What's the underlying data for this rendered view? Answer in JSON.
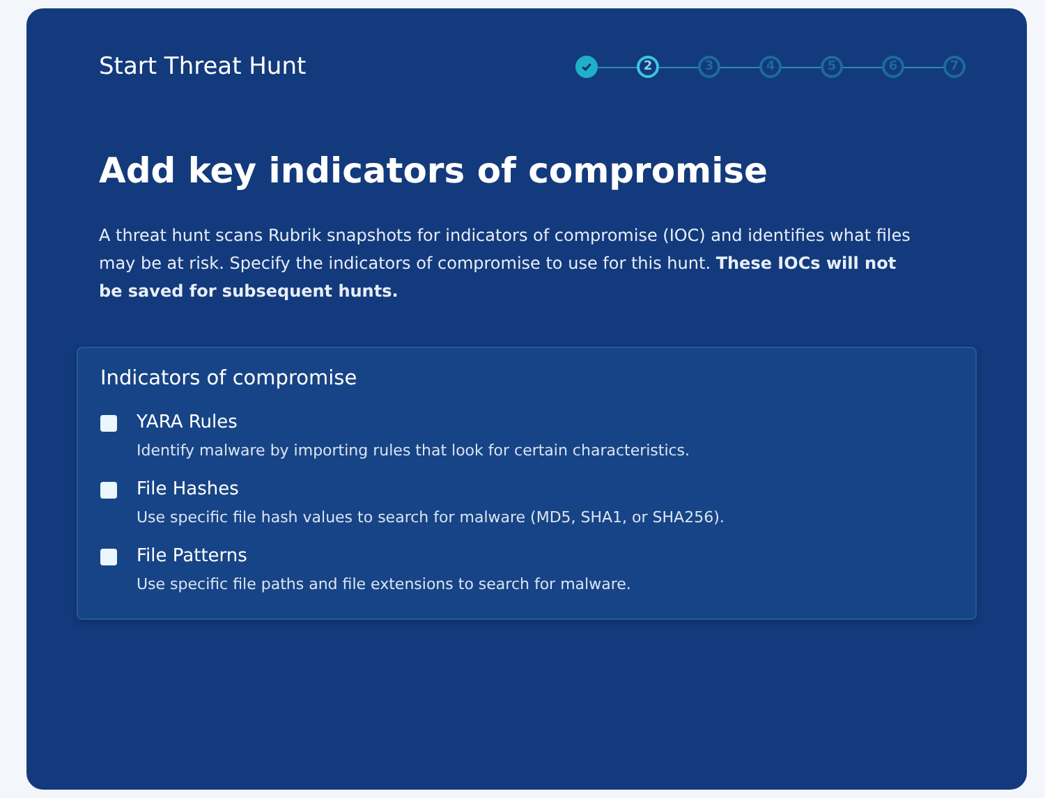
{
  "wizard": {
    "title": "Start Threat Hunt",
    "steps": [
      {
        "done": true,
        "selected": false
      },
      {
        "label": "2",
        "done": false,
        "selected": true
      },
      {
        "label": "3",
        "done": false,
        "selected": false
      },
      {
        "label": "4",
        "done": false,
        "selected": false
      },
      {
        "label": "5",
        "done": false,
        "selected": false
      },
      {
        "label": "6",
        "done": false,
        "selected": false
      },
      {
        "label": "7",
        "done": false,
        "selected": false
      }
    ]
  },
  "heading": "Add key indicators of compromise",
  "description": "A threat hunt scans Rubrik snapshots for indicators of compromise (IOC) and identifies what files may be at risk. Specify the indicators of compromise to use for this hunt. **These IOCs will not be saved for subsequent hunts.**",
  "indicators": {
    "title": "Indicators of compromise",
    "options": [
      {
        "label": "YARA Rules",
        "description": "Identify malware by importing rules that look for certain characteristics.",
        "checked": false
      },
      {
        "label": "File Hashes",
        "description": "Use specific file hash values to search for malware (MD5, SHA1, or SHA256).",
        "checked": false
      },
      {
        "label": "File Patterns",
        "description": "Use specific file paths and file extensions to search for malware.",
        "checked": false
      }
    ]
  }
}
